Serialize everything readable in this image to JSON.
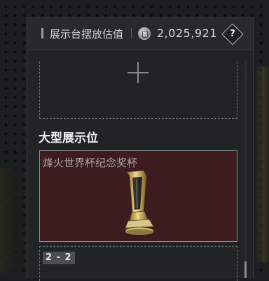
{
  "header": {
    "title": "展示台摆放估值",
    "value": "2,025,921",
    "coin_icon": "coin-icon",
    "help_label": "?"
  },
  "section": {
    "title": "大型展示位"
  },
  "slots": [
    {
      "id": "empty",
      "icon": "plus-icon"
    },
    {
      "id": "large",
      "item_name": "烽火世界杯纪念奖杯",
      "background": "#3d1b1f",
      "icon": "trophy-icon"
    },
    {
      "id": "next",
      "tag": "2 - 2"
    }
  ]
}
